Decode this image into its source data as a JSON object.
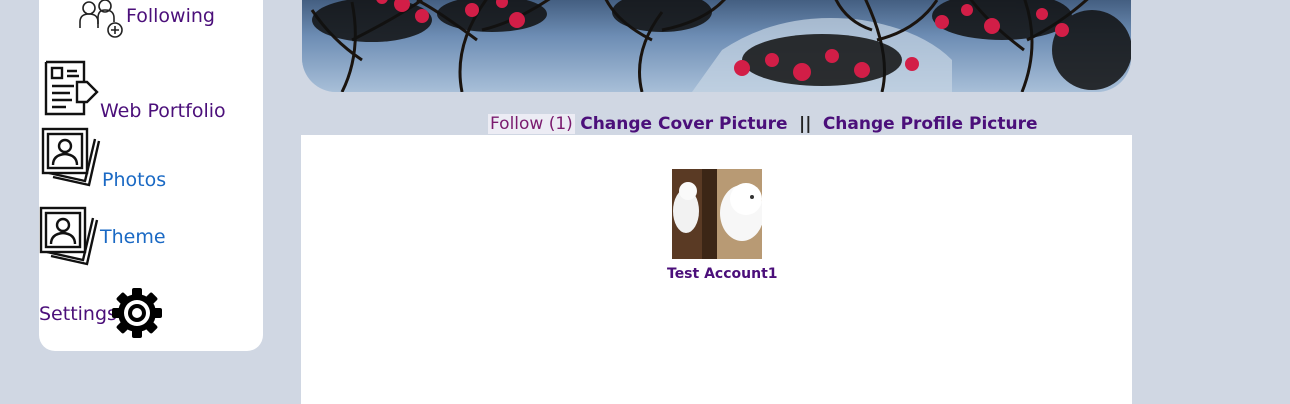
{
  "sidebar": {
    "items": [
      {
        "label": "Following",
        "icon": "following-icon"
      },
      {
        "label": "Web Portfolio",
        "icon": "portfolio-icon"
      },
      {
        "label": "Photos",
        "icon": "photos-icon"
      },
      {
        "label": "Theme",
        "icon": "theme-icon"
      },
      {
        "label": "Settings",
        "icon": "gear-icon"
      }
    ]
  },
  "profile": {
    "follow_label": "Follow (1)",
    "change_cover_label": "Change Cover Picture",
    "separator": "||",
    "change_profile_label": "Change Profile Picture"
  },
  "following": {
    "friends": [
      {
        "name": "Test Account1"
      }
    ]
  },
  "colors": {
    "background": "#d0d7e3",
    "link_purple": "#4b0f7a",
    "link_blue": "#1a69c4",
    "follow_text": "#7a1a6e"
  }
}
